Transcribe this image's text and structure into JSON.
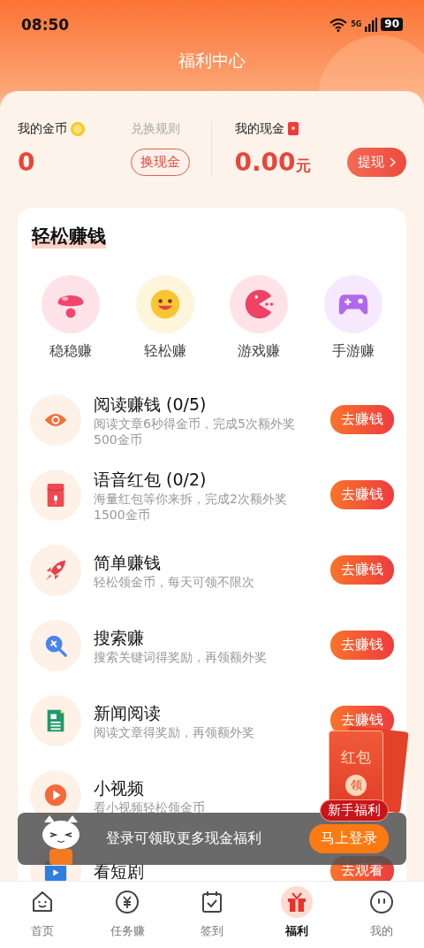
{
  "status_bar": {
    "time": "08:50",
    "network": "5G",
    "battery": "90"
  },
  "header": {
    "title": "福利中心"
  },
  "wallet": {
    "coins": {
      "label": "我的金币",
      "link": "兑换规则",
      "value": "0",
      "button": "换现金"
    },
    "cash": {
      "label": "我的现金",
      "value": "0.00",
      "unit": "元",
      "button": "提现"
    }
  },
  "earn": {
    "title": "轻松赚钱",
    "shortcuts": [
      {
        "kind": "mushroom",
        "label": "稳稳赚"
      },
      {
        "kind": "smile",
        "label": "轻松赚"
      },
      {
        "kind": "pacman",
        "label": "游戏赚"
      },
      {
        "kind": "gamepad",
        "label": "手游赚"
      }
    ],
    "tasks": [
      {
        "kind": "eye",
        "title": "阅读赚钱 (0/5)",
        "desc": "阅读文章6秒得金币，完成5次额外奖500金币",
        "button": "去赚钱"
      },
      {
        "kind": "envelope",
        "title": "语音红包 (0/2)",
        "desc": "海量红包等你来拆，完成2次额外奖1500金币",
        "button": "去赚钱"
      },
      {
        "kind": "rocket",
        "title": "简单赚钱",
        "desc": "轻松领金币，每天可领不限次",
        "button": "去赚钱"
      },
      {
        "kind": "search",
        "title": "搜索赚",
        "desc": "搜索关键词得奖励，再领额外奖",
        "button": "去赚钱"
      },
      {
        "kind": "document",
        "title": "新闻阅读",
        "desc": "阅读文章得奖励，再领额外奖",
        "button": "去赚钱"
      },
      {
        "kind": "play",
        "title": "小视频",
        "desc": "看小视频轻松领金币"
      },
      {
        "kind": "tv",
        "title": "看短剧",
        "button": "去观看"
      }
    ]
  },
  "login_banner": {
    "text": "登录可领取更多现金福利",
    "button": "马上登录"
  },
  "red_packet": {
    "title": "红包",
    "seal": "领",
    "label": "新手福利"
  },
  "tab_bar": [
    {
      "kind": "home",
      "label": "首页",
      "selected": false
    },
    {
      "kind": "yen",
      "label": "任务赚",
      "selected": false
    },
    {
      "kind": "calendar",
      "label": "签到",
      "selected": false
    },
    {
      "kind": "gift",
      "label": "福利",
      "selected": true
    },
    {
      "kind": "face",
      "label": "我的",
      "selected": false
    }
  ]
}
